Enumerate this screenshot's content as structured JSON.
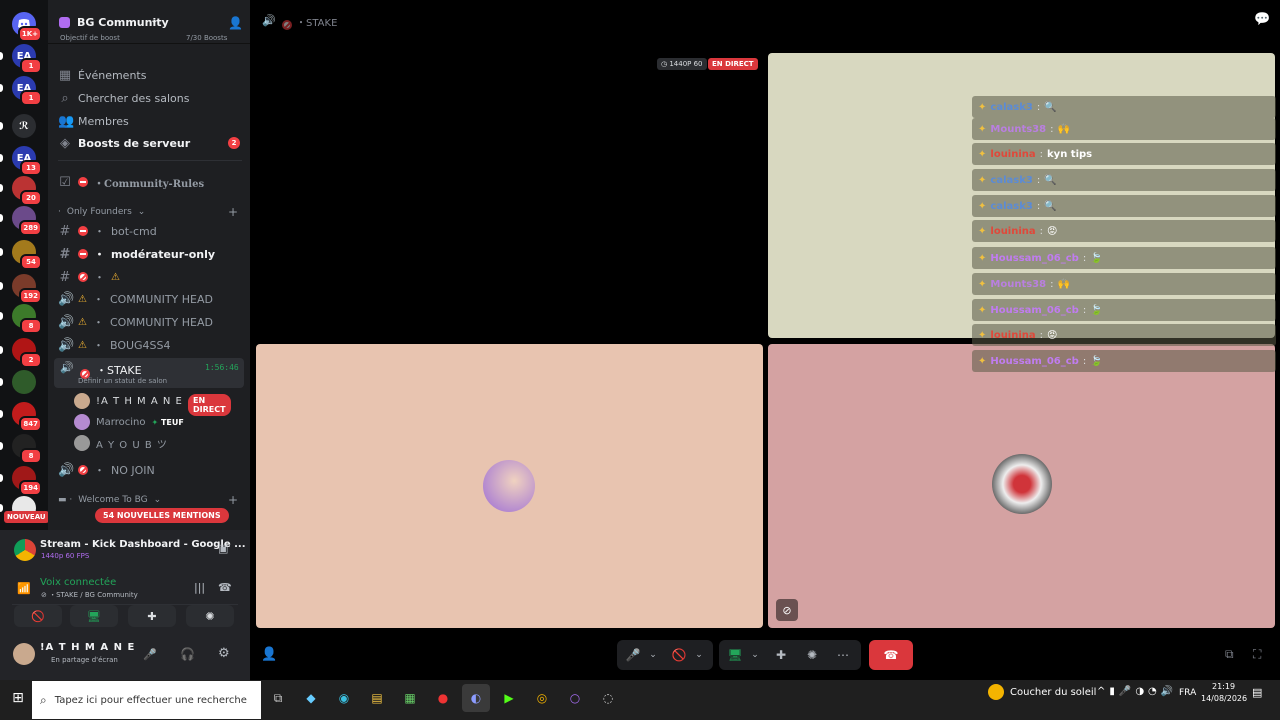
{
  "rail": {
    "top_badge": "1K+",
    "servers": [
      {
        "label": "EA",
        "badge": "1",
        "color": "#2b3bb0"
      },
      {
        "label": "EA",
        "badge": "1",
        "color": "#2b3bb0"
      },
      {
        "label": "ℛ",
        "badge": "",
        "color": "#2b2d31"
      },
      {
        "label": "EA",
        "badge": "13",
        "color": "#2b3bb0"
      },
      {
        "label": "",
        "badge": "20",
        "color": "#b33"
      },
      {
        "label": "",
        "badge": "289",
        "color": "#6b4a8a"
      },
      {
        "label": "",
        "badge": "54",
        "color": "#a37a1c"
      },
      {
        "label": "",
        "badge": "192",
        "color": "#7a3b2a"
      },
      {
        "label": "",
        "badge": "8",
        "color": "#3c7a2a"
      },
      {
        "label": "",
        "badge": "2",
        "color": "#b01515"
      },
      {
        "label": "",
        "badge": "",
        "color": "#2f5b2a"
      },
      {
        "label": "",
        "badge": "847",
        "color": "#c21c1c"
      },
      {
        "label": "",
        "badge": "8",
        "color": "#222"
      },
      {
        "label": "",
        "badge": "194",
        "color": "#a01818"
      },
      {
        "label": "",
        "badge": "",
        "color": "#e8e8e8"
      }
    ],
    "new_label": "NOUVEAU"
  },
  "guild": {
    "name": "BG Community",
    "boost_goal": "Objectif de boost",
    "boost_count": "7/30 Boosts"
  },
  "menu": [
    {
      "label": "Événements",
      "icon": "calendar-icon"
    },
    {
      "label": "Chercher des salons",
      "icon": "search-channels-icon"
    },
    {
      "label": "Membres",
      "icon": "members-icon"
    },
    {
      "label": "Boosts de serveur",
      "icon": "boost-icon",
      "badge": "2"
    }
  ],
  "channels": {
    "rules": "Community-Rules",
    "category_founders": "Only Founders",
    "bot_cmd": "bot-cmd",
    "mod_only": "modérateur-only",
    "warn_text": "⚠",
    "head1": "COMMUNITY HEAD",
    "head2": "COMMUNITY HEAD",
    "boug": "BOUG4SS4",
    "stake": "STAKE",
    "stake_time": "1:56:46",
    "stake_status": "Définir un statut de salon",
    "users": [
      {
        "name": "!A T H M A N E",
        "tag": "EN DIRECT"
      },
      {
        "name": "Marrocino",
        "tag": "TEUF"
      },
      {
        "name": "A Y O U B ツ",
        "tag": ""
      }
    ],
    "no_join": "NO JOIN",
    "category_welcome": "Welcome To BG",
    "mentions": "54 NOUVELLES MENTIONS"
  },
  "panel": {
    "stream_title": "Stream - Kick Dashboard - Google ...",
    "stream_quality": "1440p 60 FPS",
    "voice_status": "Voix connectée",
    "voice_channel": "STAKE / BG Community",
    "user_name": "!A T H M A N E",
    "user_status": "En partage d'écran"
  },
  "stage": {
    "channel": "STAKE",
    "stream_badge": "1440P 60",
    "live_badge": "EN DIRECT",
    "chat": [
      {
        "user": "calask3",
        "user_color": "#5b8bd6",
        "msg": "🔍"
      },
      {
        "user": "Mounts38",
        "user_color": "#b97fe0",
        "msg": "🙌"
      },
      {
        "user": "louinina",
        "user_color": "#e0483a",
        "msg": "kyn tips"
      },
      {
        "user": "calask3",
        "user_color": "#5b8bd6",
        "msg": "🔍"
      },
      {
        "user": "calask3",
        "user_color": "#5b8bd6",
        "msg": "🔍"
      },
      {
        "user": "louinina",
        "user_color": "#e0483a",
        "msg": "😡"
      },
      {
        "user": "Houssam_06_cb",
        "user_color": "#c07cf0",
        "msg": "🍃"
      },
      {
        "user": "Mounts38",
        "user_color": "#b97fe0",
        "msg": "🙌"
      },
      {
        "user": "Houssam_06_cb",
        "user_color": "#c07cf0",
        "msg": "🍃"
      },
      {
        "user": "louinina",
        "user_color": "#e0483a",
        "msg": "😡"
      },
      {
        "user": "Houssam_06_cb",
        "user_color": "#c07cf0",
        "msg": "🍃"
      }
    ]
  },
  "taskbar": {
    "search_placeholder": "Tapez ici pour effectuer une recherche",
    "weather": "Coucher du soleil",
    "lang": "FRA",
    "time": "21:19",
    "date": "14/08/2026"
  }
}
